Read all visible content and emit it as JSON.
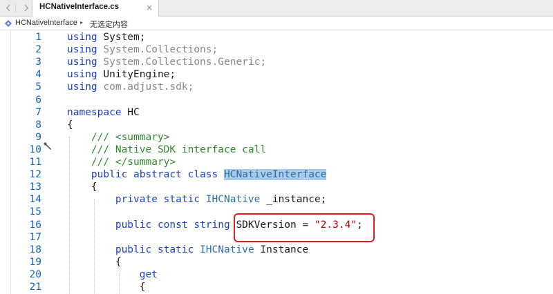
{
  "tabbar": {
    "back_icon": "chevron-left-icon",
    "forward_icon": "chevron-right-icon",
    "tab_title": "HCNativeInterface.cs",
    "close_glyph": "×"
  },
  "breadcrumb": {
    "file": "HCNativeInterface",
    "separator": "▸",
    "member": "无选定内容"
  },
  "editor": {
    "lines": [
      {
        "n": "1",
        "code": [
          [
            "kw",
            "using"
          ],
          [
            "t",
            " System;"
          ]
        ]
      },
      {
        "n": "2",
        "code": [
          [
            "kw",
            "using"
          ],
          [
            "ns",
            " System.Collections;"
          ]
        ]
      },
      {
        "n": "3",
        "code": [
          [
            "kw",
            "using"
          ],
          [
            "ns",
            " System.Collections.Generic;"
          ]
        ]
      },
      {
        "n": "4",
        "code": [
          [
            "kw",
            "using"
          ],
          [
            "t",
            " UnityEngine;"
          ]
        ]
      },
      {
        "n": "5",
        "code": [
          [
            "kw",
            "using"
          ],
          [
            "ns",
            " com.adjust.sdk;"
          ]
        ]
      },
      {
        "n": "6",
        "code": []
      },
      {
        "n": "7",
        "code": [
          [
            "kw",
            "namespace"
          ],
          [
            "t",
            " HC"
          ]
        ]
      },
      {
        "n": "8",
        "code": [
          [
            "t",
            "{"
          ]
        ]
      },
      {
        "n": "9",
        "code": [
          [
            "t",
            "    "
          ],
          [
            "cmt",
            "/// <summary>"
          ]
        ]
      },
      {
        "n": "10",
        "code": [
          [
            "t",
            "    "
          ],
          [
            "cmt",
            "/// Native SDK interface call"
          ]
        ]
      },
      {
        "n": "11",
        "code": [
          [
            "t",
            "    "
          ],
          [
            "cmt",
            "/// </summary>"
          ]
        ]
      },
      {
        "n": "12",
        "code": [
          [
            "t",
            "    "
          ],
          [
            "kw",
            "public abstract class"
          ],
          [
            "t",
            " "
          ],
          [
            "hl",
            "HCNativeInterface"
          ]
        ]
      },
      {
        "n": "13",
        "code": [
          [
            "t",
            "    {"
          ]
        ]
      },
      {
        "n": "14",
        "code": [
          [
            "t",
            "        "
          ],
          [
            "kw",
            "private static"
          ],
          [
            "t",
            " "
          ],
          [
            "type",
            "IHCNative"
          ],
          [
            "t",
            " _instance;"
          ]
        ]
      },
      {
        "n": "15",
        "code": []
      },
      {
        "n": "16",
        "code": [
          [
            "t",
            "        "
          ],
          [
            "kw",
            "public const string"
          ],
          [
            "t",
            " SDKVersion = "
          ],
          [
            "str",
            "\"2.3.4\""
          ],
          [
            "t",
            ";"
          ]
        ]
      },
      {
        "n": "17",
        "code": []
      },
      {
        "n": "18",
        "code": [
          [
            "t",
            "        "
          ],
          [
            "kw",
            "public static"
          ],
          [
            "t",
            " "
          ],
          [
            "type",
            "IHCNative"
          ],
          [
            "t",
            " Instance"
          ]
        ]
      },
      {
        "n": "19",
        "code": [
          [
            "t",
            "        {"
          ]
        ]
      },
      {
        "n": "20",
        "code": [
          [
            "t",
            "            "
          ],
          [
            "kw",
            "get"
          ]
        ]
      },
      {
        "n": "21",
        "code": [
          [
            "t",
            "            {"
          ]
        ]
      }
    ],
    "marker_icon": "wrench-icon",
    "highlight_color": "#a9cbe8",
    "callout_color": "#e02020"
  }
}
